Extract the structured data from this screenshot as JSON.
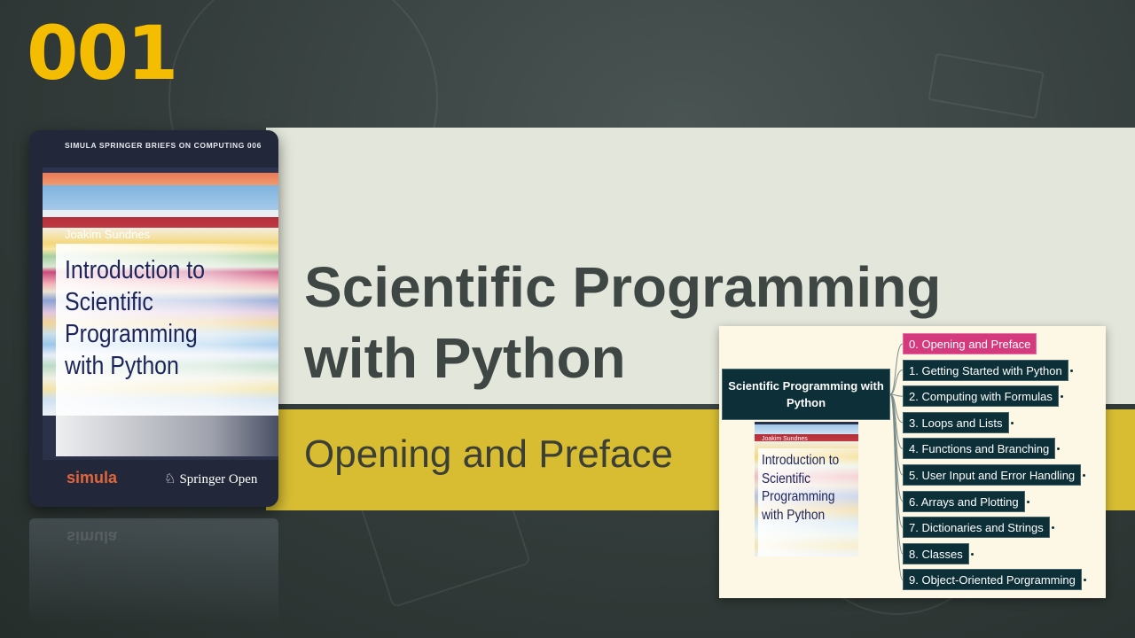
{
  "episode_number": "001",
  "title": "Scientific Programming with Python",
  "subtitle": "Opening and Preface",
  "colors": {
    "accent_yellow": "#f5bd02",
    "title_band": "#e3e6da",
    "subtitle_band": "#d8bd33",
    "node_dark": "#0d3038",
    "node_active": "#d63a7e"
  },
  "book": {
    "series": "SIMULA SPRINGER BRIEFS ON COMPUTING   006",
    "author": "Joakim Sundnes",
    "title": "Introduction to Scientific Programming with Python",
    "publisher_left": "simula",
    "publisher_right": "Springer Open",
    "publisher_icon": "springer-horse-icon"
  },
  "mindmap": {
    "root": "Scientific Programming with Python",
    "cover_author": "Joakim Sundnes",
    "cover_title": "Introduction to Scientific Programming with Python",
    "chapters": [
      "0. Opening and Preface",
      "1. Getting Started with Python",
      "2. Computing with Formulas",
      "3. Loops and Lists",
      "4. Functions and Branching",
      "5. User Input and Error Handling",
      "6. Arrays and Plotting",
      "7. Dictionaries and Strings",
      "8. Classes",
      "9. Object-Oriented Porgramming"
    ],
    "active_index": 0
  }
}
